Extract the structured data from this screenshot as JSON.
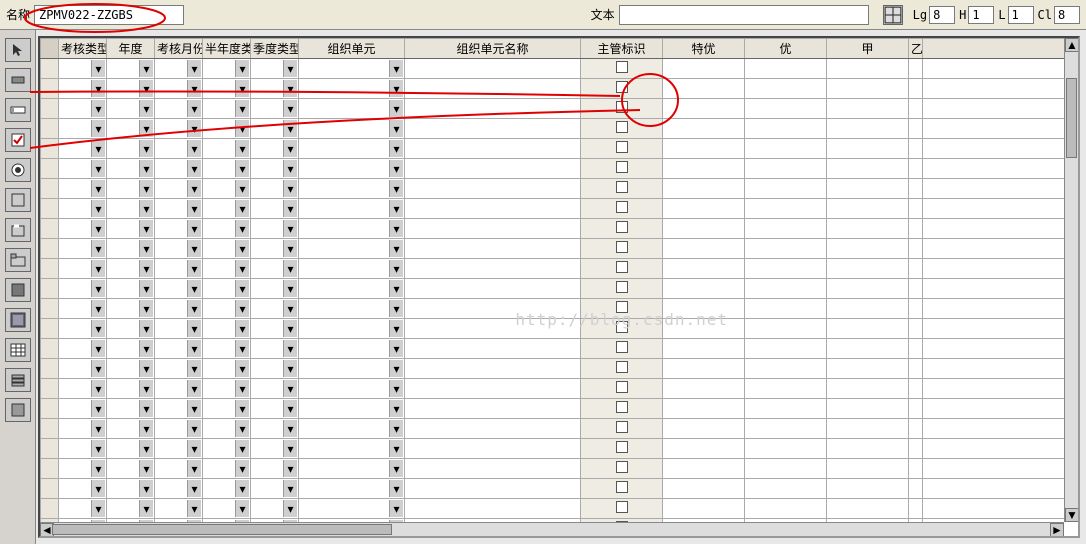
{
  "topbar": {
    "name_label": "名称",
    "name_value": "ZPMV022-ZZGBS",
    "text_label": "文本",
    "text_value": "",
    "lg_label": "Lg",
    "lg_value": "8",
    "h_label": "H",
    "h_value": "1",
    "l_label": "L",
    "l_value": "1",
    "cl_label": "Cl",
    "cl_value": "8"
  },
  "columns": [
    "考核类型",
    "年度",
    "考核月份",
    "半年度类",
    "季度类型",
    "组织单元",
    "组织单元名称",
    "主管标识",
    "特优",
    "优",
    "甲",
    "乙"
  ],
  "dropdown_col_indices": [
    0,
    1,
    2,
    3,
    4,
    5
  ],
  "checkbox_col_index": 7,
  "row_count": 24,
  "watermark": "http://blog.csdn.net",
  "palette_tools": [
    "pointer",
    "button",
    "edit-box",
    "checkbox",
    "radio",
    "frame",
    "group-box",
    "tabstrip",
    "custom-ctrl",
    "subscreen",
    "table-ctrl",
    "step-loop",
    "status-icon"
  ]
}
